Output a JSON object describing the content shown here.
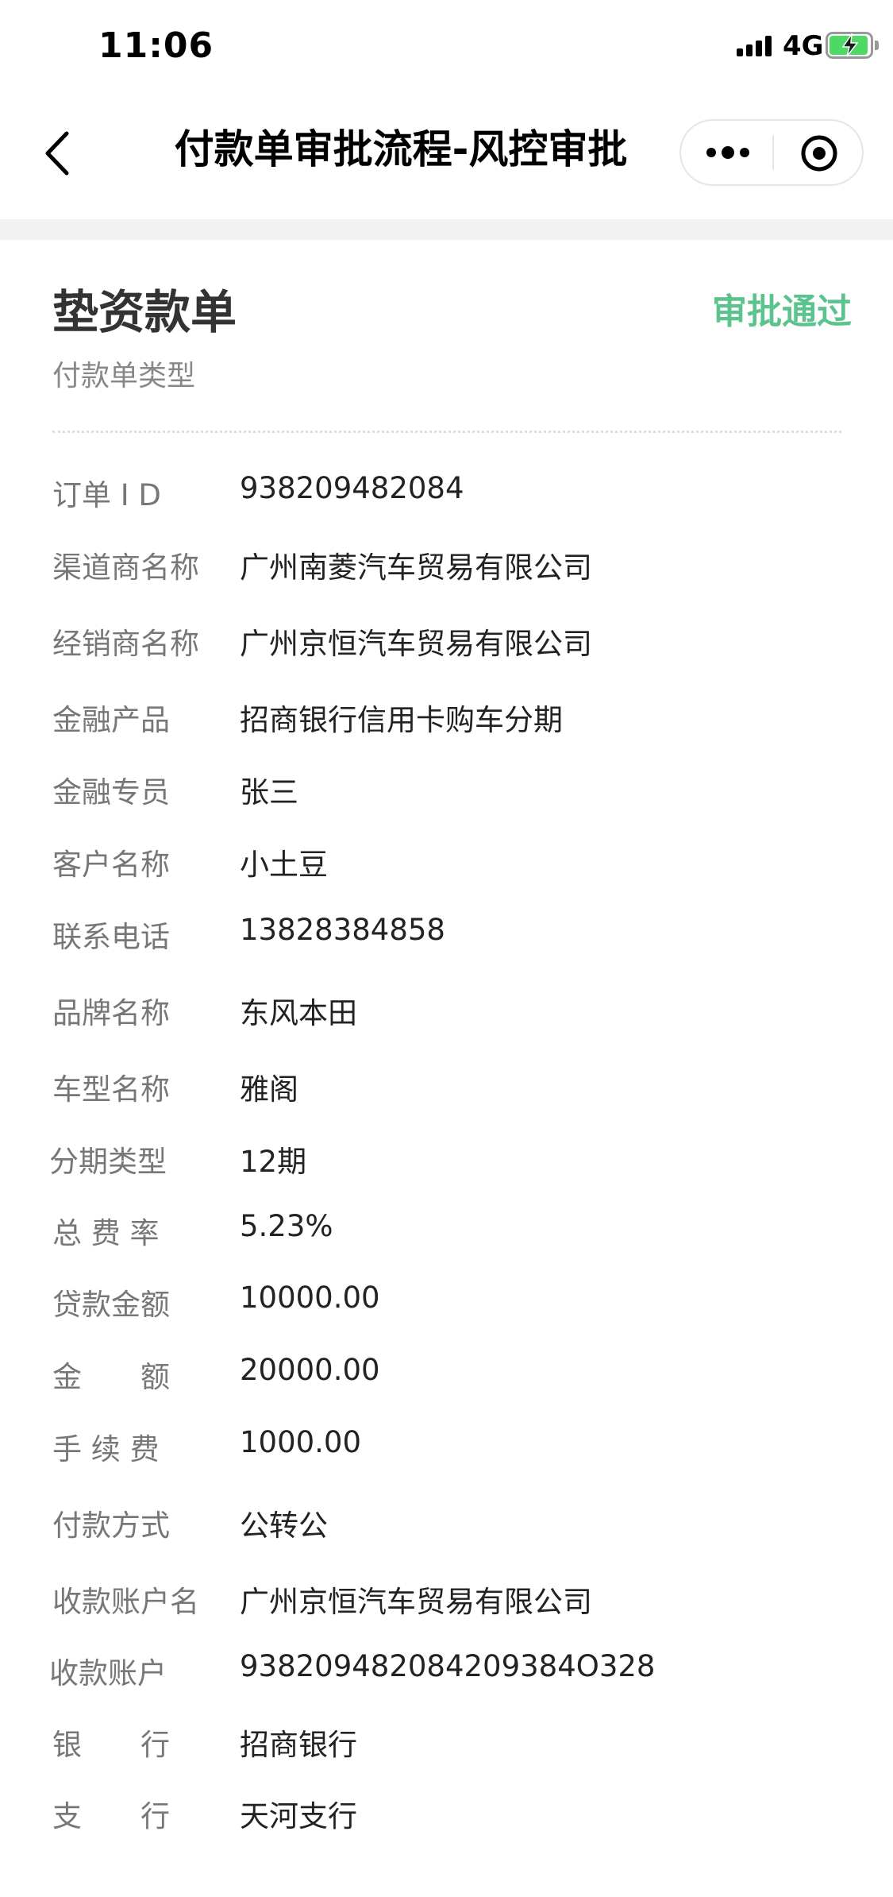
{
  "status_bar": {
    "time": "11:06",
    "network": "4G",
    "icons": [
      "signal-icon",
      "battery-charging-icon"
    ],
    "battery_color": "#4cd964"
  },
  "nav": {
    "title": "付款单审批流程-风控审批",
    "icons": [
      "chevron-left-icon",
      "more-dots-icon",
      "close-circle-icon"
    ]
  },
  "header": {
    "title": "垫资款单",
    "subtitle": "付款单类型",
    "status": "审批通过",
    "status_color": "#5cc28e"
  },
  "details": [
    {
      "label": "订单 I D",
      "value": "938209482084"
    },
    {
      "label": "渠道商名称",
      "value": "广州南菱汽车贸易有限公司"
    },
    {
      "label": "经销商名称",
      "value": "广州京恒汽车贸易有限公司"
    },
    {
      "label": "金融产品",
      "value": "招商银行信用卡购车分期"
    },
    {
      "label": "金融专员",
      "value": "张三"
    },
    {
      "label": "客户名称",
      "value": "小土豆"
    },
    {
      "label": "联系电话",
      "value": "13828384858"
    },
    {
      "label": "品牌名称",
      "value": "东风本田"
    },
    {
      "label": "车型名称",
      "value": "雅阁"
    },
    {
      "label": "分期类型",
      "value": "12期"
    },
    {
      "label": "总 费 率",
      "value": "5.23%"
    },
    {
      "label": "贷款金额",
      "value": "10000.00"
    },
    {
      "label": "金　　额",
      "value": "20000.00"
    },
    {
      "label": "手 续 费",
      "value": "1000.00"
    },
    {
      "label": "付款方式",
      "value": "公转公"
    },
    {
      "label": "收款账户名",
      "value": "广州京恒汽车贸易有限公司"
    },
    {
      "label": "收款账户",
      "value": "938209482084209384O328"
    },
    {
      "label": "银　　行",
      "value": "招商银行"
    },
    {
      "label": "支　　行",
      "value": "天河支行"
    }
  ]
}
